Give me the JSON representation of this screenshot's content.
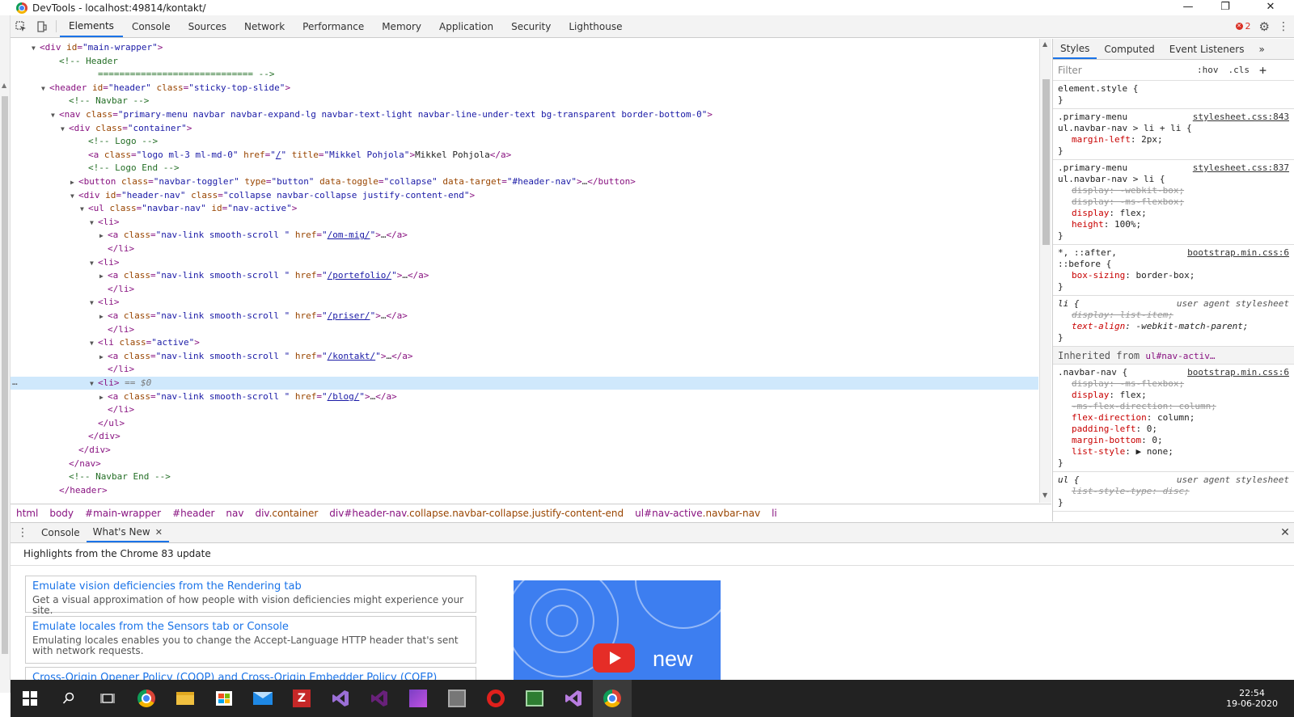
{
  "window": {
    "title": "DevTools - localhost:49814/kontakt/",
    "minimize": "—",
    "restore": "❐",
    "close": "✕"
  },
  "toolbar": {
    "inspect_icon": "inspect-element-icon",
    "device_icon": "device-toolbar-icon",
    "tabs": [
      "Elements",
      "Console",
      "Sources",
      "Network",
      "Performance",
      "Memory",
      "Application",
      "Security",
      "Lighthouse"
    ],
    "active_tab": "Elements",
    "error_count": "2",
    "settings_icon": "⚙",
    "more_icon": "⋮"
  },
  "dom": {
    "lines": [
      {
        "indent": 3,
        "tri": "▼",
        "html": "<span class=\"tag\">&lt;div</span> <span class=\"attr\">id</span><span class=\"tag\">=</span><span class=\"val\">\"main-wrapper\"</span><span class=\"tag\">&gt;</span>"
      },
      {
        "indent": 5,
        "tri": "",
        "html": "<span class=\"comment\">&lt;!-- Header</span>"
      },
      {
        "indent": 9,
        "tri": "",
        "html": "<span class=\"comment\">============================= --&gt;</span>"
      },
      {
        "indent": 4,
        "tri": "▼",
        "html": "<span class=\"tag\">&lt;header</span> <span class=\"attr\">id</span><span class=\"tag\">=</span><span class=\"val\">\"header\"</span> <span class=\"attr\">class</span><span class=\"tag\">=</span><span class=\"val\">\"sticky-top-slide\"</span><span class=\"tag\">&gt;</span>"
      },
      {
        "indent": 6,
        "tri": "",
        "html": "<span class=\"comment\">&lt;!-- Navbar --&gt;</span>"
      },
      {
        "indent": 5,
        "tri": "▼",
        "html": "<span class=\"tag\">&lt;nav</span> <span class=\"attr\">class</span><span class=\"tag\">=</span><span class=\"val\">\"primary-menu navbar navbar-expand-lg navbar-text-light navbar-line-under-text bg-transparent border-bottom-0\"</span><span class=\"tag\">&gt;</span>"
      },
      {
        "indent": 6,
        "tri": "▼",
        "html": "<span class=\"tag\">&lt;div</span> <span class=\"attr\">class</span><span class=\"tag\">=</span><span class=\"val\">\"container\"</span><span class=\"tag\">&gt;</span>"
      },
      {
        "indent": 8,
        "tri": "",
        "html": "<span class=\"comment\">&lt;!-- Logo --&gt;</span>"
      },
      {
        "indent": 8,
        "tri": "",
        "html": "<span class=\"tag\">&lt;a</span> <span class=\"attr\">class</span><span class=\"tag\">=</span><span class=\"val\">\"logo ml-3 ml-md-0\"</span> <span class=\"attr\">href</span><span class=\"tag\">=</span><span class=\"val\">\"<span class=\"link\">/</span>\"</span> <span class=\"attr\">title</span><span class=\"tag\">=</span><span class=\"val\">\"Mikkel Pohjola\"</span><span class=\"tag\">&gt;</span><span class=\"txt\">Mikkel Pohjola</span><span class=\"tag\">&lt;/a&gt;</span>"
      },
      {
        "indent": 8,
        "tri": "",
        "html": "<span class=\"comment\">&lt;!-- Logo End --&gt;</span>"
      },
      {
        "indent": 7,
        "tri": "▶",
        "html": "<span class=\"tag\">&lt;button</span> <span class=\"attr\">class</span><span class=\"tag\">=</span><span class=\"val\">\"navbar-toggler\"</span> <span class=\"attr\">type</span><span class=\"tag\">=</span><span class=\"val\">\"button\"</span> <span class=\"attr\">data-toggle</span><span class=\"tag\">=</span><span class=\"val\">\"collapse\"</span> <span class=\"attr\">data-target</span><span class=\"tag\">=</span><span class=\"val\">\"#header-nav\"</span><span class=\"tag\">&gt;</span>…<span class=\"tag\">&lt;/button&gt;</span>"
      },
      {
        "indent": 7,
        "tri": "▼",
        "html": "<span class=\"tag\">&lt;div</span> <span class=\"attr\">id</span><span class=\"tag\">=</span><span class=\"val\">\"header-nav\"</span> <span class=\"attr\">class</span><span class=\"tag\">=</span><span class=\"val\">\"collapse navbar-collapse justify-content-end\"</span><span class=\"tag\">&gt;</span>"
      },
      {
        "indent": 8,
        "tri": "▼",
        "html": "<span class=\"tag\">&lt;ul</span> <span class=\"attr\">class</span><span class=\"tag\">=</span><span class=\"val\">\"navbar-nav\"</span> <span class=\"attr\">id</span><span class=\"tag\">=</span><span class=\"val\">\"nav-active\"</span><span class=\"tag\">&gt;</span>"
      },
      {
        "indent": 9,
        "tri": "▼",
        "html": "<span class=\"tag\">&lt;li&gt;</span>"
      },
      {
        "indent": 10,
        "tri": "▶",
        "html": "<span class=\"tag\">&lt;a</span> <span class=\"attr\">class</span><span class=\"tag\">=</span><span class=\"val\">\"nav-link smooth-scroll \"</span> <span class=\"attr\">href</span><span class=\"tag\">=</span><span class=\"val\">\"<span class=\"link\">/om-mig/</span>\"</span><span class=\"tag\">&gt;</span>…<span class=\"tag\">&lt;/a&gt;</span>"
      },
      {
        "indent": 10,
        "tri": "",
        "html": "<span class=\"tag\">&lt;/li&gt;</span>"
      },
      {
        "indent": 9,
        "tri": "▼",
        "html": "<span class=\"tag\">&lt;li&gt;</span>"
      },
      {
        "indent": 10,
        "tri": "▶",
        "html": "<span class=\"tag\">&lt;a</span> <span class=\"attr\">class</span><span class=\"tag\">=</span><span class=\"val\">\"nav-link smooth-scroll \"</span> <span class=\"attr\">href</span><span class=\"tag\">=</span><span class=\"val\">\"<span class=\"link\">/portefolio/</span>\"</span><span class=\"tag\">&gt;</span>…<span class=\"tag\">&lt;/a&gt;</span>"
      },
      {
        "indent": 10,
        "tri": "",
        "html": "<span class=\"tag\">&lt;/li&gt;</span>"
      },
      {
        "indent": 9,
        "tri": "▼",
        "html": "<span class=\"tag\">&lt;li&gt;</span>"
      },
      {
        "indent": 10,
        "tri": "▶",
        "html": "<span class=\"tag\">&lt;a</span> <span class=\"attr\">class</span><span class=\"tag\">=</span><span class=\"val\">\"nav-link smooth-scroll \"</span> <span class=\"attr\">href</span><span class=\"tag\">=</span><span class=\"val\">\"<span class=\"link\">/priser/</span>\"</span><span class=\"tag\">&gt;</span>…<span class=\"tag\">&lt;/a&gt;</span>"
      },
      {
        "indent": 10,
        "tri": "",
        "html": "<span class=\"tag\">&lt;/li&gt;</span>"
      },
      {
        "indent": 9,
        "tri": "▼",
        "html": "<span class=\"tag\">&lt;li</span> <span class=\"attr\">class</span><span class=\"tag\">=</span><span class=\"val\">\"active\"</span><span class=\"tag\">&gt;</span>"
      },
      {
        "indent": 10,
        "tri": "▶",
        "html": "<span class=\"tag\">&lt;a</span> <span class=\"attr\">class</span><span class=\"tag\">=</span><span class=\"val\">\"nav-link smooth-scroll \"</span> <span class=\"attr\">href</span><span class=\"tag\">=</span><span class=\"val\">\"<span class=\"link\">/kontakt/</span>\"</span><span class=\"tag\">&gt;</span>…<span class=\"tag\">&lt;/a&gt;</span>"
      },
      {
        "indent": 10,
        "tri": "",
        "html": "<span class=\"tag\">&lt;/li&gt;</span>"
      },
      {
        "indent": 9,
        "tri": "▼",
        "html": "<span class=\"tag\">&lt;li&gt;</span> <span class=\"eq\">== $0</span>",
        "selected": true
      },
      {
        "indent": 10,
        "tri": "▶",
        "html": "<span class=\"tag\">&lt;a</span> <span class=\"attr\">class</span><span class=\"tag\">=</span><span class=\"val\">\"nav-link smooth-scroll \"</span> <span class=\"attr\">href</span><span class=\"tag\">=</span><span class=\"val\">\"<span class=\"link\">/blog/</span>\"</span><span class=\"tag\">&gt;</span>…<span class=\"tag\">&lt;/a&gt;</span>"
      },
      {
        "indent": 10,
        "tri": "",
        "html": "<span class=\"tag\">&lt;/li&gt;</span>"
      },
      {
        "indent": 9,
        "tri": "",
        "html": "<span class=\"tag\">&lt;/ul&gt;</span>"
      },
      {
        "indent": 8,
        "tri": "",
        "html": "<span class=\"tag\">&lt;/div&gt;</span>"
      },
      {
        "indent": 7,
        "tri": "",
        "html": "<span class=\"tag\">&lt;/div&gt;</span>"
      },
      {
        "indent": 6,
        "tri": "",
        "html": "<span class=\"tag\">&lt;/nav&gt;</span>"
      },
      {
        "indent": 6,
        "tri": "",
        "html": "<span class=\"comment\">&lt;!-- Navbar End --&gt;</span>"
      },
      {
        "indent": 5,
        "tri": "",
        "html": "<span class=\"tag\">&lt;/header&gt;</span>"
      }
    ],
    "selected_marker": "…"
  },
  "breadcrumbs": [
    {
      "tag": "html",
      "cls": ""
    },
    {
      "tag": "body",
      "cls": ""
    },
    {
      "tag": "#main-wrapper",
      "cls": ""
    },
    {
      "tag": "#header",
      "cls": ""
    },
    {
      "tag": "nav",
      "cls": ""
    },
    {
      "tag": "div",
      "cls": ".container"
    },
    {
      "tag": "div#header-nav",
      "cls": ".collapse.navbar-collapse.justify-content-end"
    },
    {
      "tag": "ul#nav-active",
      "cls": ".navbar-nav"
    },
    {
      "tag": "li",
      "cls": ""
    }
  ],
  "styles": {
    "tabs": [
      "Styles",
      "Computed",
      "Event Listeners"
    ],
    "more": "»",
    "filter_placeholder": "Filter",
    "hov": ":hov",
    "cls": ".cls",
    "add": "+",
    "rules": [
      {
        "selector": "element.style {",
        "source": "",
        "ua": false,
        "decls": [],
        "close": "}"
      },
      {
        "selector": ".primary-menu\nul.navbar-nav > li + li {",
        "source": "stylesheet.css:843",
        "ua": false,
        "decls": [
          {
            "p": "margin-left",
            "v": "2px",
            "strike": false,
            "italic": false
          }
        ],
        "close": "}"
      },
      {
        "selector": ".primary-menu\nul.navbar-nav > li {",
        "source": "stylesheet.css:837",
        "ua": false,
        "decls": [
          {
            "p": "display",
            "v": "-webkit-box",
            "strike": true,
            "italic": false
          },
          {
            "p": "display",
            "v": "-ms-flexbox",
            "strike": true,
            "italic": false
          },
          {
            "p": "display",
            "v": "flex",
            "strike": false,
            "italic": false
          },
          {
            "p": "height",
            "v": "100%",
            "strike": false,
            "italic": false
          }
        ],
        "close": "}"
      },
      {
        "selector": "*, ::after,\n::before {",
        "source": "bootstrap.min.css:6",
        "ua": false,
        "decls": [
          {
            "p": "box-sizing",
            "v": "border-box",
            "strike": false,
            "italic": false
          }
        ],
        "close": "}"
      },
      {
        "selector": "li {",
        "source": "user agent stylesheet",
        "ua": true,
        "decls": [
          {
            "p": "display",
            "v": "list-item",
            "strike": true,
            "italic": true
          },
          {
            "p": "text-align",
            "v": "-webkit-match-parent",
            "strike": false,
            "italic": true
          }
        ],
        "close": "}"
      }
    ],
    "inherited_label": "Inherited from",
    "inherited_from": "ul#nav-activ…",
    "inherited_rules": [
      {
        "selector": ".navbar-nav {",
        "source": "bootstrap.min.css:6",
        "ua": false,
        "decls": [
          {
            "p": "display",
            "v": "-ms-flexbox",
            "strike": true,
            "italic": false
          },
          {
            "p": "display",
            "v": "flex",
            "strike": false,
            "italic": false
          },
          {
            "p": "-ms-flex-direction",
            "v": "column",
            "strike": true,
            "italic": false
          },
          {
            "p": "flex-direction",
            "v": "column",
            "strike": false,
            "italic": false
          },
          {
            "p": "padding-left",
            "v": "0",
            "strike": false,
            "italic": false
          },
          {
            "p": "margin-bottom",
            "v": "0",
            "strike": false,
            "italic": false
          },
          {
            "p": "list-style",
            "v": "▶ none",
            "strike": false,
            "italic": false
          }
        ],
        "close": "}"
      },
      {
        "selector": "ul {",
        "source": "user agent stylesheet",
        "ua": true,
        "decls": [
          {
            "p": "list-style-type",
            "v": "disc",
            "strike": true,
            "italic": true
          }
        ],
        "close": "}"
      }
    ]
  },
  "drawer": {
    "tabs": [
      "Console",
      "What's New"
    ],
    "active_tab": "What's New",
    "tab_close": "✕",
    "close": "✕",
    "headline": "Highlights from the Chrome 83 update",
    "cards": [
      {
        "title": "Emulate vision deficiencies from the Rendering tab",
        "desc": "Get a visual approximation of how people with vision deficiencies might experience your site."
      },
      {
        "title": "Emulate locales from the Sensors tab or Console",
        "desc": "Emulating locales enables you to change the Accept-Language HTTP header that's sent with network requests."
      },
      {
        "title": "Cross-Origin Opener Policy (COOP) and Cross-Origin Embedder Policy (COEP) debugging",
        "desc": ""
      }
    ],
    "video_text": "new"
  },
  "taskbar": {
    "clock_time": "22:54",
    "clock_date": "19-06-2020",
    "icons": [
      "windows-start-icon",
      "search-icon",
      "task-view-icon",
      "chrome-icon",
      "file-explorer-icon",
      "store-icon",
      "mail-icon",
      "filezilla-icon",
      "visual-studio-icon",
      "visual-studio-alt-icon",
      "affinity-icon",
      "tools-icon",
      "opera-icon",
      "spreadsheet-icon",
      "visual-studio-code-icon",
      "chrome-devtools-icon"
    ]
  }
}
